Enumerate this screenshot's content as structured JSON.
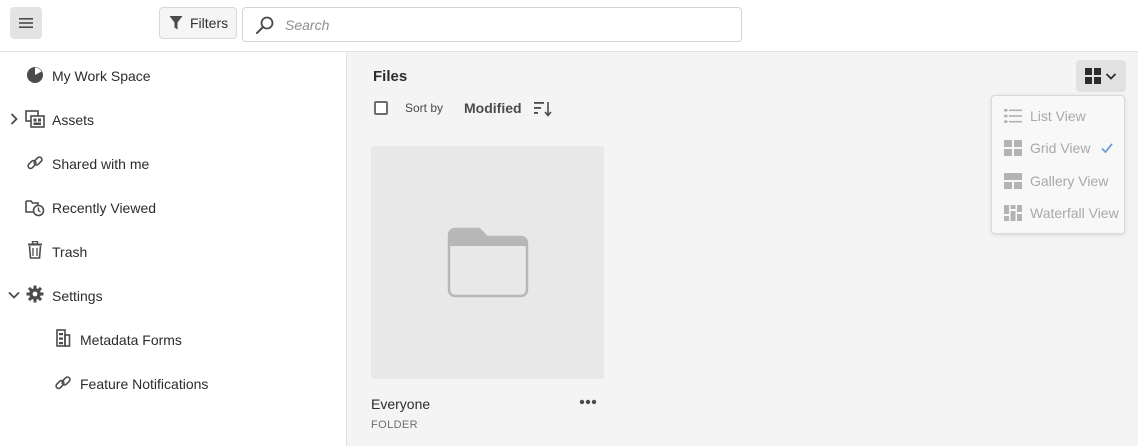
{
  "topbar": {
    "menu_icon": "hamburger-icon",
    "filters_label": "Filters",
    "filters_icon": "funnel-icon",
    "search_icon": "magnifier-icon",
    "search_placeholder": "Search",
    "search_value": ""
  },
  "sidebar": {
    "items": [
      {
        "label": "My Work Space",
        "icon": "workspace-icon",
        "expandable": false
      },
      {
        "label": "Assets",
        "icon": "assets-icon",
        "expandable": true,
        "expanded": false
      },
      {
        "label": "Shared with me",
        "icon": "link-icon",
        "expandable": false
      },
      {
        "label": "Recently Viewed",
        "icon": "recent-icon",
        "expandable": false
      },
      {
        "label": "Trash",
        "icon": "trash-icon",
        "expandable": false
      },
      {
        "label": "Settings",
        "icon": "gear-icon",
        "expandable": true,
        "expanded": true
      },
      {
        "label": "Metadata Forms",
        "icon": "forms-icon",
        "expandable": false
      },
      {
        "label": "Feature Notifications",
        "icon": "link-icon",
        "expandable": false
      }
    ]
  },
  "main": {
    "title": "Files",
    "sort_by_label": "Sort by",
    "sort_field": "Modified",
    "sort_order_icon": "sort-order-icon",
    "view_toggle_icon": "grid-view-icon",
    "view_menu": [
      {
        "label": "List View",
        "icon": "list-view-icon",
        "selected": false
      },
      {
        "label": "Grid View",
        "icon": "grid-view-icon",
        "selected": true
      },
      {
        "label": "Gallery View",
        "icon": "gallery-view-icon",
        "selected": false
      },
      {
        "label": "Waterfall View",
        "icon": "waterfall-view-icon",
        "selected": false
      }
    ],
    "cards": [
      {
        "name": "Everyone",
        "type": "FOLDER",
        "icon": "folder-icon"
      }
    ]
  },
  "colors": {
    "sidebar_bg": "#ffffff",
    "main_bg": "#f4f4f4",
    "card_bg": "#e8e8e8",
    "menu_text": "#a9a9a9",
    "check_color": "#6e9fd6"
  }
}
